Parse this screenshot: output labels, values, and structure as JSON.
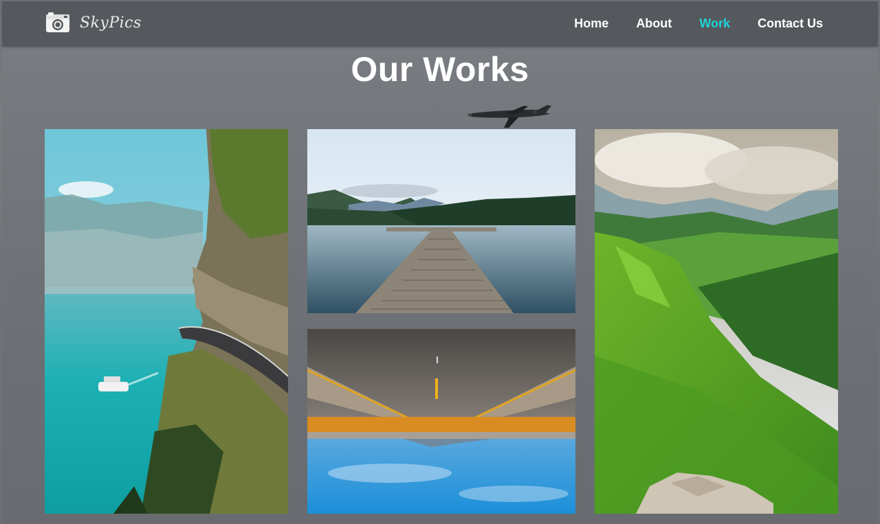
{
  "brand": {
    "name": "SkyPics",
    "logo_icon": "camera-icon"
  },
  "nav": {
    "items": [
      {
        "label": "Home",
        "active": false
      },
      {
        "label": "About",
        "active": false
      },
      {
        "label": "Work",
        "active": true
      },
      {
        "label": "Contact Us",
        "active": false
      }
    ],
    "active_color": "#1ed3d8"
  },
  "page": {
    "title": "Our Works",
    "decoration_icon": "airplane-icon"
  },
  "gallery": [
    {
      "subject": "coastal cliff road above turquoise lake with ferry"
    },
    {
      "subject": "wooden pier on calm mountain lake"
    },
    {
      "subject": "road reflected upside down over blue sky"
    },
    {
      "subject": "green alpine valley under cloudy sky"
    }
  ]
}
